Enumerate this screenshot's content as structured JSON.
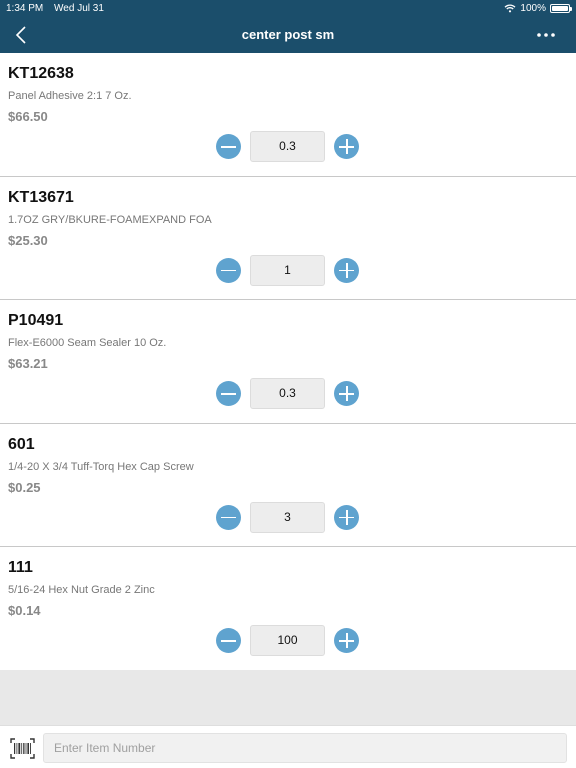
{
  "status_bar": {
    "time": "1:34 PM",
    "date": "Wed Jul 31",
    "battery": "100%"
  },
  "header": {
    "title": "center post sm"
  },
  "items": [
    {
      "code": "KT12638",
      "description": "Panel Adhesive 2:1 7 Oz.",
      "price": "$66.50",
      "quantity": "0.3"
    },
    {
      "code": "KT13671",
      "description": "1.7OZ GRY/BKURE-FOAMEXPAND FOA",
      "price": "$25.30",
      "quantity": "1"
    },
    {
      "code": "P10491",
      "description": "Flex-E6000 Seam Sealer 10 Oz.",
      "price": "$63.21",
      "quantity": "0.3"
    },
    {
      "code": "601",
      "description": "1/4-20 X 3/4 Tuff-Torq Hex Cap Screw",
      "price": "$0.25",
      "quantity": "3"
    },
    {
      "code": "111",
      "description": "5/16-24 Hex Nut Grade 2 Zinc",
      "price": "$0.14",
      "quantity": "100"
    }
  ],
  "search": {
    "placeholder": "Enter Item Number",
    "value": ""
  },
  "colors": {
    "header": "#1b4e6b",
    "stepper_button": "#5fa3cf"
  }
}
